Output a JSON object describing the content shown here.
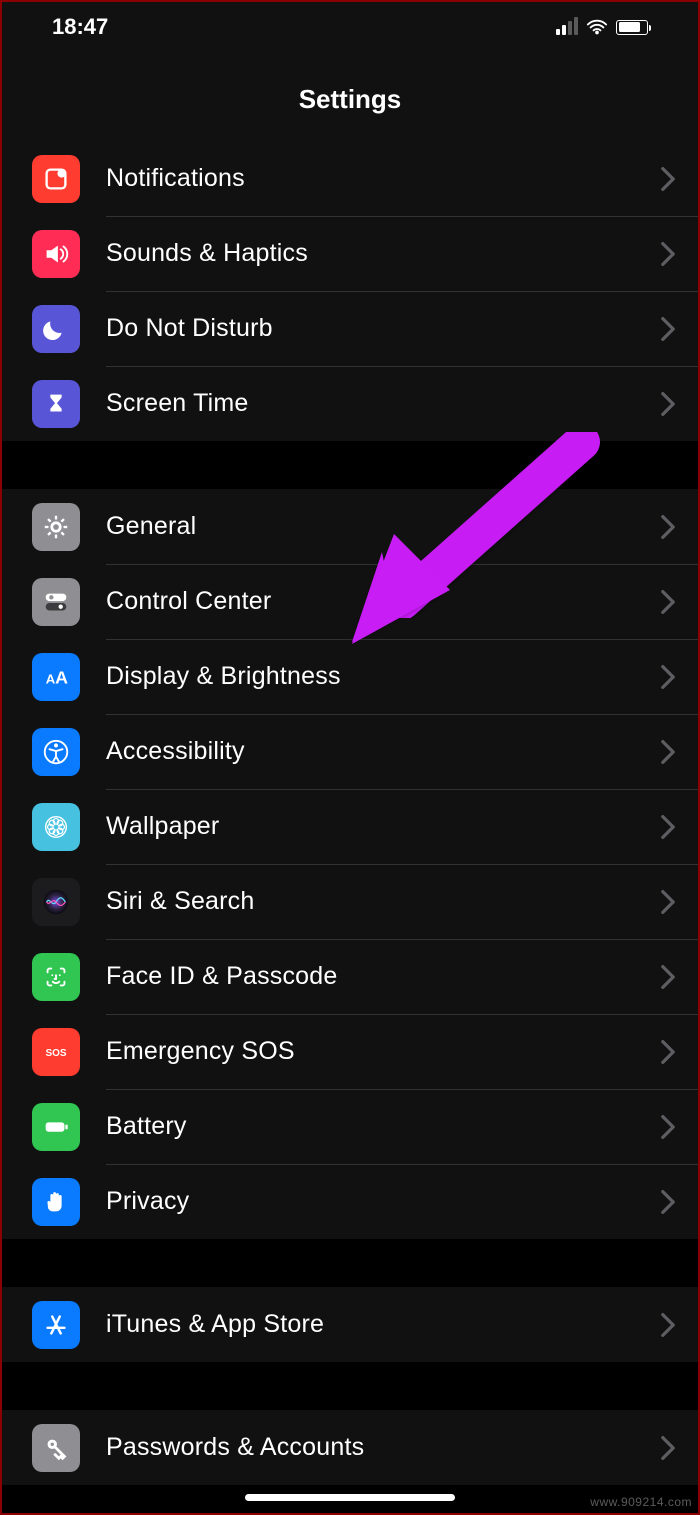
{
  "statusBar": {
    "time": "18:47"
  },
  "header": {
    "title": "Settings"
  },
  "groups": [
    {
      "rows": [
        {
          "id": "notifications",
          "label": "Notifications",
          "icon": "notifications-icon",
          "bg": "#ff3c30"
        },
        {
          "id": "sounds",
          "label": "Sounds & Haptics",
          "icon": "sounds-icon",
          "bg": "#ff2d55"
        },
        {
          "id": "dnd",
          "label": "Do Not Disturb",
          "icon": "moon-icon",
          "bg": "#5856d6"
        },
        {
          "id": "screentime",
          "label": "Screen Time",
          "icon": "hourglass-icon",
          "bg": "#5856d6"
        }
      ]
    },
    {
      "rows": [
        {
          "id": "general",
          "label": "General",
          "icon": "gear-icon",
          "bg": "#8e8e93"
        },
        {
          "id": "controlcenter",
          "label": "Control Center",
          "icon": "switches-icon",
          "bg": "#8e8e93"
        },
        {
          "id": "display",
          "label": "Display & Brightness",
          "icon": "textsize-icon",
          "bg": "#0a7aff"
        },
        {
          "id": "accessibility",
          "label": "Accessibility",
          "icon": "accessibility-icon",
          "bg": "#0a7aff"
        },
        {
          "id": "wallpaper",
          "label": "Wallpaper",
          "icon": "wallpaper-icon",
          "bg": "#46c2e0"
        },
        {
          "id": "siri",
          "label": "Siri & Search",
          "icon": "siri-icon",
          "bg": "#1c1c1e"
        },
        {
          "id": "faceid",
          "label": "Face ID & Passcode",
          "icon": "faceid-icon",
          "bg": "#31c552"
        },
        {
          "id": "sos",
          "label": "Emergency SOS",
          "icon": "sos-icon",
          "bg": "#ff3c30"
        },
        {
          "id": "battery",
          "label": "Battery",
          "icon": "battery-icon",
          "bg": "#31c552"
        },
        {
          "id": "privacy",
          "label": "Privacy",
          "icon": "hand-icon",
          "bg": "#0a7aff"
        }
      ]
    },
    {
      "rows": [
        {
          "id": "itunes",
          "label": "iTunes & App Store",
          "icon": "appstore-icon",
          "bg": "#0a7aff"
        }
      ]
    },
    {
      "rows": [
        {
          "id": "passwords",
          "label": "Passwords & Accounts",
          "icon": "key-icon",
          "bg": "#8e8e93"
        }
      ]
    }
  ],
  "watermark": "www.909214.com"
}
